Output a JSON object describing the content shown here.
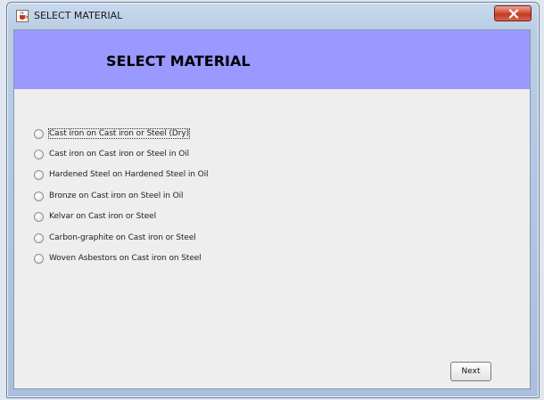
{
  "window": {
    "title": "SELECT MATERIAL",
    "icon": "java-cup-icon",
    "close_icon": "close-x-icon"
  },
  "header": {
    "title": "SELECT MATERIAL",
    "background": "#9999ff"
  },
  "materials": [
    {
      "label": "Cast iron on Cast iron or Steel (Dry)",
      "selected": false,
      "focused": true
    },
    {
      "label": " Cast iron on Cast iron or Steel in Oil",
      "selected": false
    },
    {
      "label": "Hardened Steel on Hardened Steel in Oil",
      "selected": false
    },
    {
      "label": "Bronze on Cast iron on Steel in Oil",
      "selected": false
    },
    {
      "label": "Kelvar on Cast iron or Steel",
      "selected": false
    },
    {
      "label": "Carbon-graphite on Cast iron or Steel",
      "selected": false
    },
    {
      "label": "Woven Asbestors on Cast iron on Steel",
      "selected": false
    }
  ],
  "buttons": {
    "next_label": "Next"
  }
}
